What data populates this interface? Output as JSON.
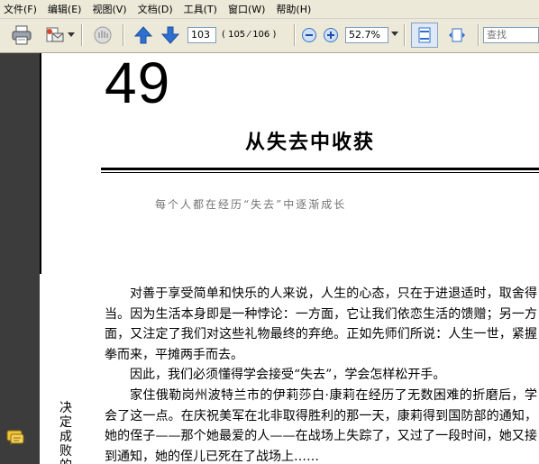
{
  "menu": [
    "文件(F)",
    "编辑(E)",
    "视图(V)",
    "文档(D)",
    "工具(T)",
    "窗口(W)",
    "帮助(H)"
  ],
  "toolbar": {
    "page_number": "103",
    "page_count": "( 105 ⁄ 106 )",
    "zoom": "52.7%",
    "search_placeholder": "查找"
  },
  "document": {
    "chapter_number": "49",
    "chapter_title": "从失去中收获",
    "epigraph": "每个人都在经历“失去”中逐渐成长",
    "paragraphs": [
      "对善于享受简单和快乐的人来说，人生的心态，只在于进退适时，取舍得当。因为生活本身即是一种悖论：一方面，它让我们依恋生活的馈赠；另一方面，又注定了我们对这些礼物最终的弃绝。正如先师们所说：人生一世，紧握拳而来，平摊两手而去。",
      "因此，我们必须懂得学会接受“失去”，学会怎样松开手。",
      "家住俄勒岗州波特兰市的伊莉莎白·康莉在经历了无数困难的折磨后，学会了这一点。在庆祝美军在北非取得胜利的那一天，康莉得到国防部的通知，她的侄子——那个她最爱的人——在战场上失踪了，又过了一段时间，她又接到通知，她的侄儿已死在了战场上……"
    ],
    "margin_note": "决定成败的"
  },
  "colors": {
    "chrome": "#ece9d8",
    "side_panel": "#3c3c3c",
    "accent_blue": "#2f6fd0"
  },
  "icons": [
    "print-icon",
    "email-icon",
    "hand-tool-icon",
    "previous-page-icon",
    "next-page-icon",
    "zoom-out-icon",
    "zoom-in-icon",
    "dropdown-arrow-icon",
    "fit-page-icon",
    "fit-width-icon",
    "comment-icon"
  ]
}
